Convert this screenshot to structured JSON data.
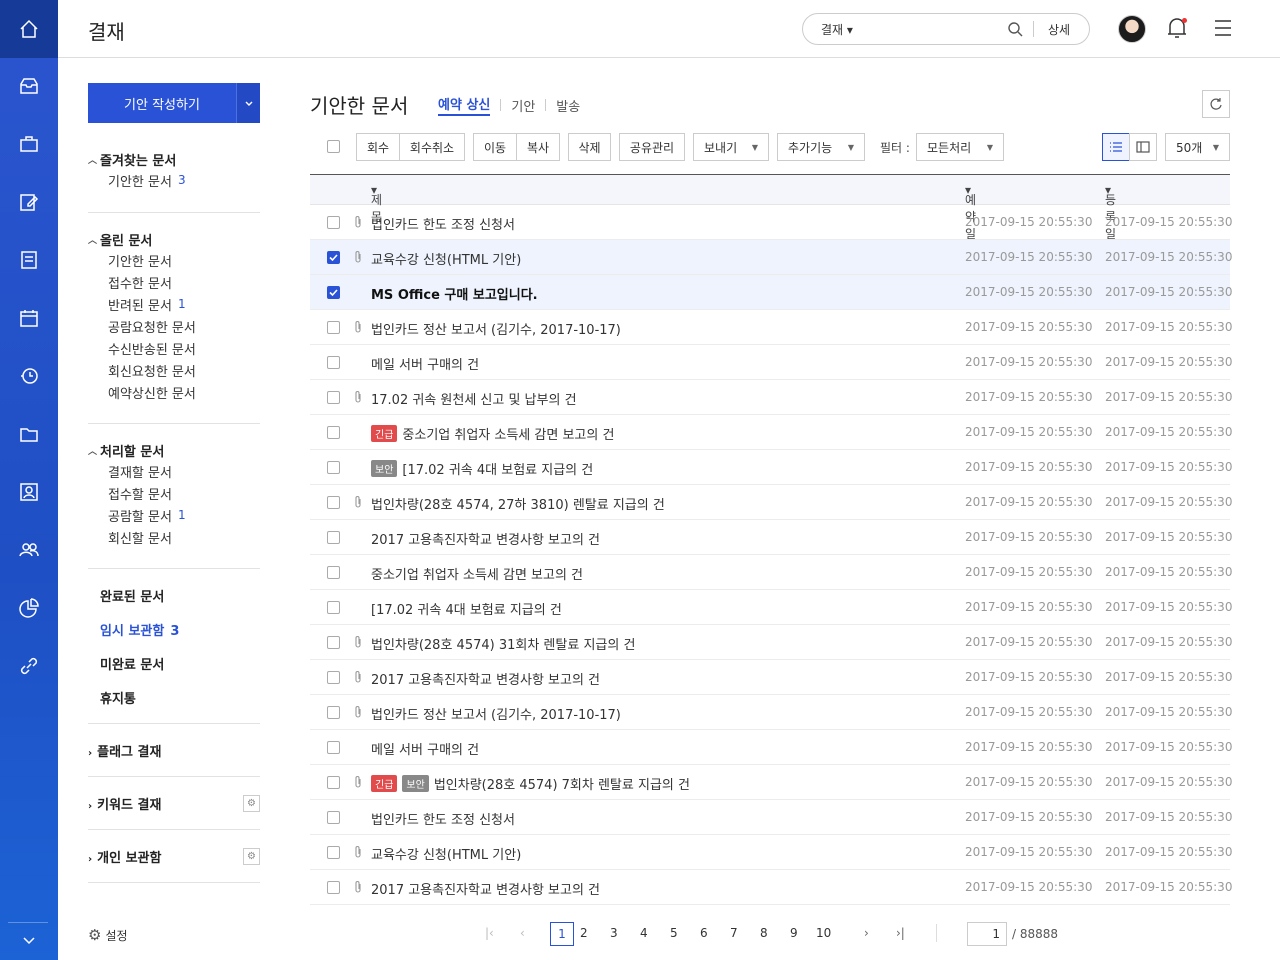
{
  "header": {
    "title": "결재",
    "search_scope": "결재",
    "detail": "상세"
  },
  "sidebar": {
    "write": "기안 작성하기",
    "fav": {
      "title": "즐겨찾는 문서",
      "items": [
        {
          "label": "기안한 문서",
          "count": "3"
        }
      ]
    },
    "up": {
      "title": "올린 문서",
      "items": [
        {
          "label": "기안한 문서",
          "count": ""
        },
        {
          "label": "접수한 문서",
          "count": ""
        },
        {
          "label": "반려된 문서",
          "count": "1"
        },
        {
          "label": "공람요청한 문서",
          "count": ""
        },
        {
          "label": "수신반송된 문서",
          "count": ""
        },
        {
          "label": "회신요청한 문서",
          "count": ""
        },
        {
          "label": "예약상신한 문서",
          "count": ""
        }
      ]
    },
    "todo": {
      "title": "처리할 문서",
      "items": [
        {
          "label": "결재할 문서",
          "count": ""
        },
        {
          "label": "접수할 문서",
          "count": ""
        },
        {
          "label": "공람할 문서",
          "count": "1"
        },
        {
          "label": "회신할 문서",
          "count": ""
        }
      ]
    },
    "done": "완료된 문서",
    "temp": {
      "label": "임시 보관함",
      "count": "3"
    },
    "incomplete": "미완료 문서",
    "trash": "휴지통",
    "flag": "플래그 결재",
    "keyword": "키워드 결재",
    "personal": "개인 보관함",
    "settings": "설정"
  },
  "main": {
    "title": "기안한 문서",
    "tabs": [
      "예약 상신",
      "기안",
      "발송"
    ],
    "toolbar": {
      "recall": "회수",
      "recall_cancel": "회수취소",
      "move": "이동",
      "copy": "복사",
      "delete": "삭제",
      "share": "공유관리",
      "send": "보내기",
      "more": "추가기능",
      "filter_label": "필터 :",
      "filter_value": "모든처리",
      "page_size": "50개"
    },
    "columns": {
      "subject": "제목",
      "reserved": "예약일",
      "registered": "등록일"
    },
    "rows": [
      {
        "subject": "법인카드 한도 조정 신청서",
        "clip": true,
        "checked": false,
        "bold": false,
        "tags": [],
        "d1": "2017-09-15 20:55:30",
        "d2": "2017-09-15 20:55:30"
      },
      {
        "subject": "교육수강 신청(HTML 기안)",
        "clip": true,
        "checked": true,
        "bold": false,
        "tags": [],
        "d1": "2017-09-15 20:55:30",
        "d2": "2017-09-15 20:55:30"
      },
      {
        "subject": "MS Office 구매 보고입니다.",
        "clip": false,
        "checked": true,
        "bold": true,
        "tags": [],
        "d1": "2017-09-15 20:55:30",
        "d2": "2017-09-15 20:55:30"
      },
      {
        "subject": "법인카드 정산 보고서 (김기수, 2017-10-17)",
        "clip": true,
        "checked": false,
        "bold": false,
        "tags": [],
        "d1": "2017-09-15 20:55:30",
        "d2": "2017-09-15 20:55:30"
      },
      {
        "subject": "메일 서버 구매의 건",
        "clip": false,
        "checked": false,
        "bold": false,
        "tags": [],
        "d1": "2017-09-15 20:55:30",
        "d2": "2017-09-15 20:55:30"
      },
      {
        "subject": "17.02 귀속 원천세 신고 및 납부의 건",
        "clip": true,
        "checked": false,
        "bold": false,
        "tags": [],
        "d1": "2017-09-15 20:55:30",
        "d2": "2017-09-15 20:55:30"
      },
      {
        "subject": "중소기업 취업자 소득세 감면 보고의 건",
        "clip": false,
        "checked": false,
        "bold": false,
        "tags": [
          "긴급"
        ],
        "d1": "2017-09-15 20:55:30",
        "d2": "2017-09-15 20:55:30"
      },
      {
        "subject": "[17.02 귀속 4대 보험료 지급의 건",
        "clip": false,
        "checked": false,
        "bold": false,
        "tags": [
          "보안"
        ],
        "d1": "2017-09-15 20:55:30",
        "d2": "2017-09-15 20:55:30"
      },
      {
        "subject": "법인차량(28호 4574, 27하 3810) 렌탈료 지급의 건",
        "clip": true,
        "checked": false,
        "bold": false,
        "tags": [],
        "d1": "2017-09-15 20:55:30",
        "d2": "2017-09-15 20:55:30"
      },
      {
        "subject": "2017 고용촉진자학교 변경사항 보고의 건",
        "clip": false,
        "checked": false,
        "bold": false,
        "tags": [],
        "d1": "2017-09-15 20:55:30",
        "d2": "2017-09-15 20:55:30"
      },
      {
        "subject": "중소기업 취업자 소득세 감면 보고의 건",
        "clip": false,
        "checked": false,
        "bold": false,
        "tags": [],
        "d1": "2017-09-15 20:55:30",
        "d2": "2017-09-15 20:55:30"
      },
      {
        "subject": "[17.02 귀속 4대 보험료 지급의 건",
        "clip": false,
        "checked": false,
        "bold": false,
        "tags": [],
        "d1": "2017-09-15 20:55:30",
        "d2": "2017-09-15 20:55:30"
      },
      {
        "subject": "법인차량(28호 4574) 31회차 렌탈료 지급의 건",
        "clip": true,
        "checked": false,
        "bold": false,
        "tags": [],
        "d1": "2017-09-15 20:55:30",
        "d2": "2017-09-15 20:55:30"
      },
      {
        "subject": "2017 고용촉진자학교 변경사항 보고의 건",
        "clip": true,
        "checked": false,
        "bold": false,
        "tags": [],
        "d1": "2017-09-15 20:55:30",
        "d2": "2017-09-15 20:55:30"
      },
      {
        "subject": "법인카드 정산 보고서 (김기수, 2017-10-17)",
        "clip": true,
        "checked": false,
        "bold": false,
        "tags": [],
        "d1": "2017-09-15 20:55:30",
        "d2": "2017-09-15 20:55:30"
      },
      {
        "subject": "메일 서버 구매의 건",
        "clip": false,
        "checked": false,
        "bold": false,
        "tags": [],
        "d1": "2017-09-15 20:55:30",
        "d2": "2017-09-15 20:55:30"
      },
      {
        "subject": "법인차량(28호 4574) 7회차 렌탈료 지급의 건",
        "clip": true,
        "checked": false,
        "bold": false,
        "tags": [
          "긴급",
          "보안"
        ],
        "d1": "2017-09-15 20:55:30",
        "d2": "2017-09-15 20:55:30"
      },
      {
        "subject": "법인카드 한도 조정 신청서",
        "clip": false,
        "checked": false,
        "bold": false,
        "tags": [],
        "d1": "2017-09-15 20:55:30",
        "d2": "2017-09-15 20:55:30"
      },
      {
        "subject": "교육수강 신청(HTML 기안)",
        "clip": true,
        "checked": false,
        "bold": false,
        "tags": [],
        "d1": "2017-09-15 20:55:30",
        "d2": "2017-09-15 20:55:30"
      },
      {
        "subject": "2017 고용촉진자학교 변경사항 보고의 건",
        "clip": true,
        "checked": false,
        "bold": false,
        "tags": [],
        "d1": "2017-09-15 20:55:30",
        "d2": "2017-09-15 20:55:30"
      }
    ],
    "pager": {
      "pages": [
        "1",
        "2",
        "3",
        "4",
        "5",
        "6",
        "7",
        "8",
        "9",
        "10"
      ],
      "current": "1",
      "input": "1",
      "total": "/ 88888"
    }
  },
  "colors": {
    "accent": "#2a52d6",
    "rail": "#1f4fc4",
    "urgent": "#e14b4b",
    "secure": "#888888"
  }
}
